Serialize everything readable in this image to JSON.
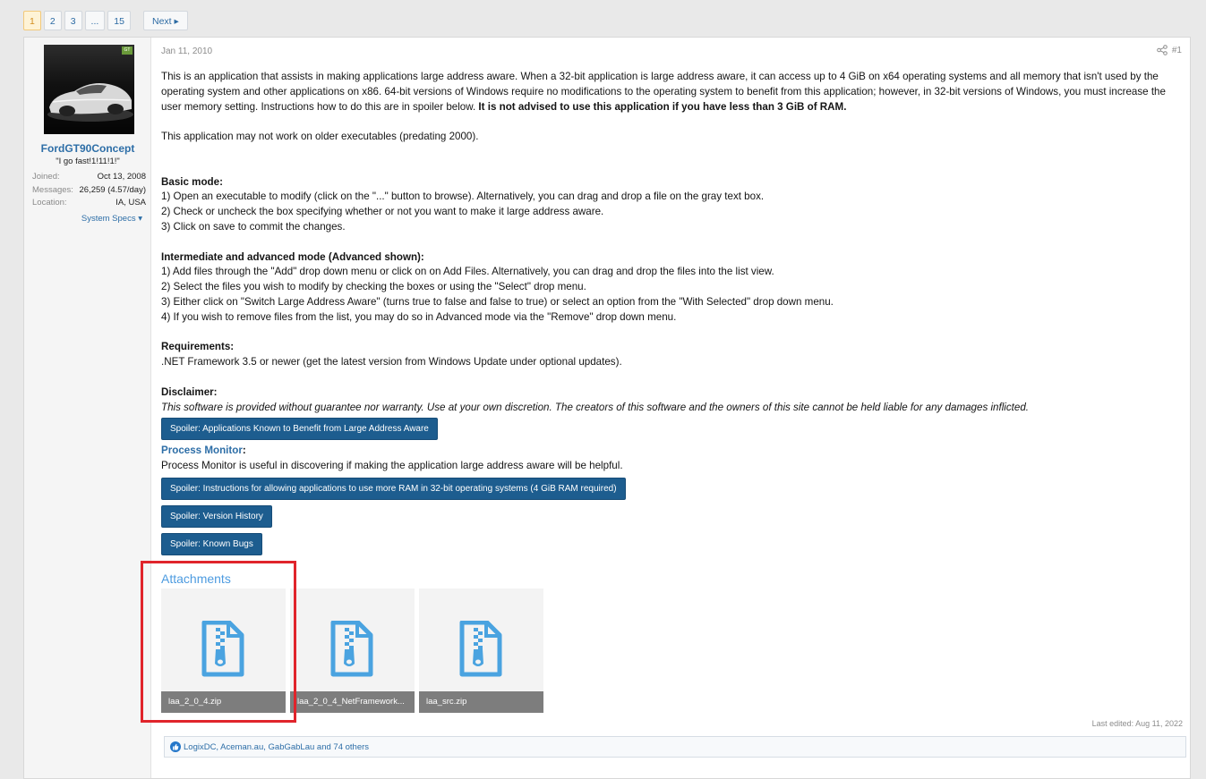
{
  "pagination": {
    "pages": [
      "1",
      "2",
      "3",
      "...",
      "15"
    ],
    "active": "1",
    "next": "Next ▸"
  },
  "user": {
    "name": "FordGT90Concept",
    "title": "\"I go fast!1!11!1!\"",
    "stats": [
      {
        "label": "Joined:",
        "value": "Oct 13, 2008"
      },
      {
        "label": "Messages:",
        "value": "26,259 (4.57/day)"
      },
      {
        "label": "Location:",
        "value": "IA, USA"
      }
    ],
    "specs_link": "System Specs ▾",
    "online_badge": "GT"
  },
  "post": {
    "date": "Jan 11, 2010",
    "number": "#1",
    "intro": "This is an application that assists in making applications large address aware. When a 32-bit application is large address aware, it can access up to 4 GiB on x64 operating systems and all memory that isn't used by the operating system and other applications on x86. 64-bit versions of Windows require no modifications to the operating system to benefit from this application; however, in 32-bit versions of Windows, you must increase the user memory setting. Instructions how to do this are in spoiler below. ",
    "intro_bold": "It is not advised to use this application if you have less than 3 GiB of RAM.",
    "older_note": "This application may not work on older executables (predating 2000).",
    "basic_heading": "Basic mode:",
    "basic_steps": [
      "1) Open an executable to modify (click on the \"...\" button to browse). Alternatively, you can drag and drop a file on the gray text box.",
      "2) Check or uncheck the box specifying whether or not you want to make it large address aware.",
      "3) Click on save to commit the changes."
    ],
    "adv_heading": "Intermediate and advanced mode (Advanced shown):",
    "adv_steps": [
      "1) Add files through the \"Add\" drop down menu or click on on Add Files. Alternatively, you can drag and drop the files into the list view.",
      "2) Select the files you wish to modify by checking the boxes or using the \"Select\" drop menu.",
      "3) Either click on \"Switch Large Address Aware\" (turns true to false and false to true) or select an option from the \"With Selected\" drop down menu.",
      "4) If you wish to remove files from the list, you may do so in Advanced mode via the \"Remove\" drop down menu."
    ],
    "req_heading": "Requirements:",
    "req_text": ".NET Framework 3.5 or newer (get the latest version from Windows Update under optional updates).",
    "disc_heading": "Disclaimer:",
    "disc_text": "This software is provided without guarantee nor warranty. Use at your own discretion. The creators of this software and the owners of this site cannot be held liable for any damages inflicted.",
    "spoiler_apps": "Spoiler: Applications Known to Benefit from Large Address Aware",
    "pm_heading": "Process Monitor",
    "pm_colon": ":",
    "pm_text": "Process Monitor is useful in discovering if making the application large address aware will be helpful.",
    "spoiler_ram": "Spoiler: Instructions for allowing applications to use more RAM in 32-bit operating systems (4 GiB RAM required)",
    "spoiler_history": "Spoiler: Version History",
    "spoiler_bugs": "Spoiler: Known Bugs",
    "attachments_title": "Attachments",
    "attachments": [
      {
        "name": "laa_2_0_4.zip"
      },
      {
        "name": "laa_2_0_4_NetFramework..."
      },
      {
        "name": "laa_src.zip"
      }
    ],
    "last_edited": "Last edited: Aug 11, 2022",
    "reactions": "LogixDC, Aceman.au, GabGabLau and 74 others"
  },
  "colors": {
    "link": "#2d6ea7",
    "spoiler_button": "#1d5d8f",
    "attachment_icon": "#4aa3e0",
    "highlight": "#e0242b"
  }
}
